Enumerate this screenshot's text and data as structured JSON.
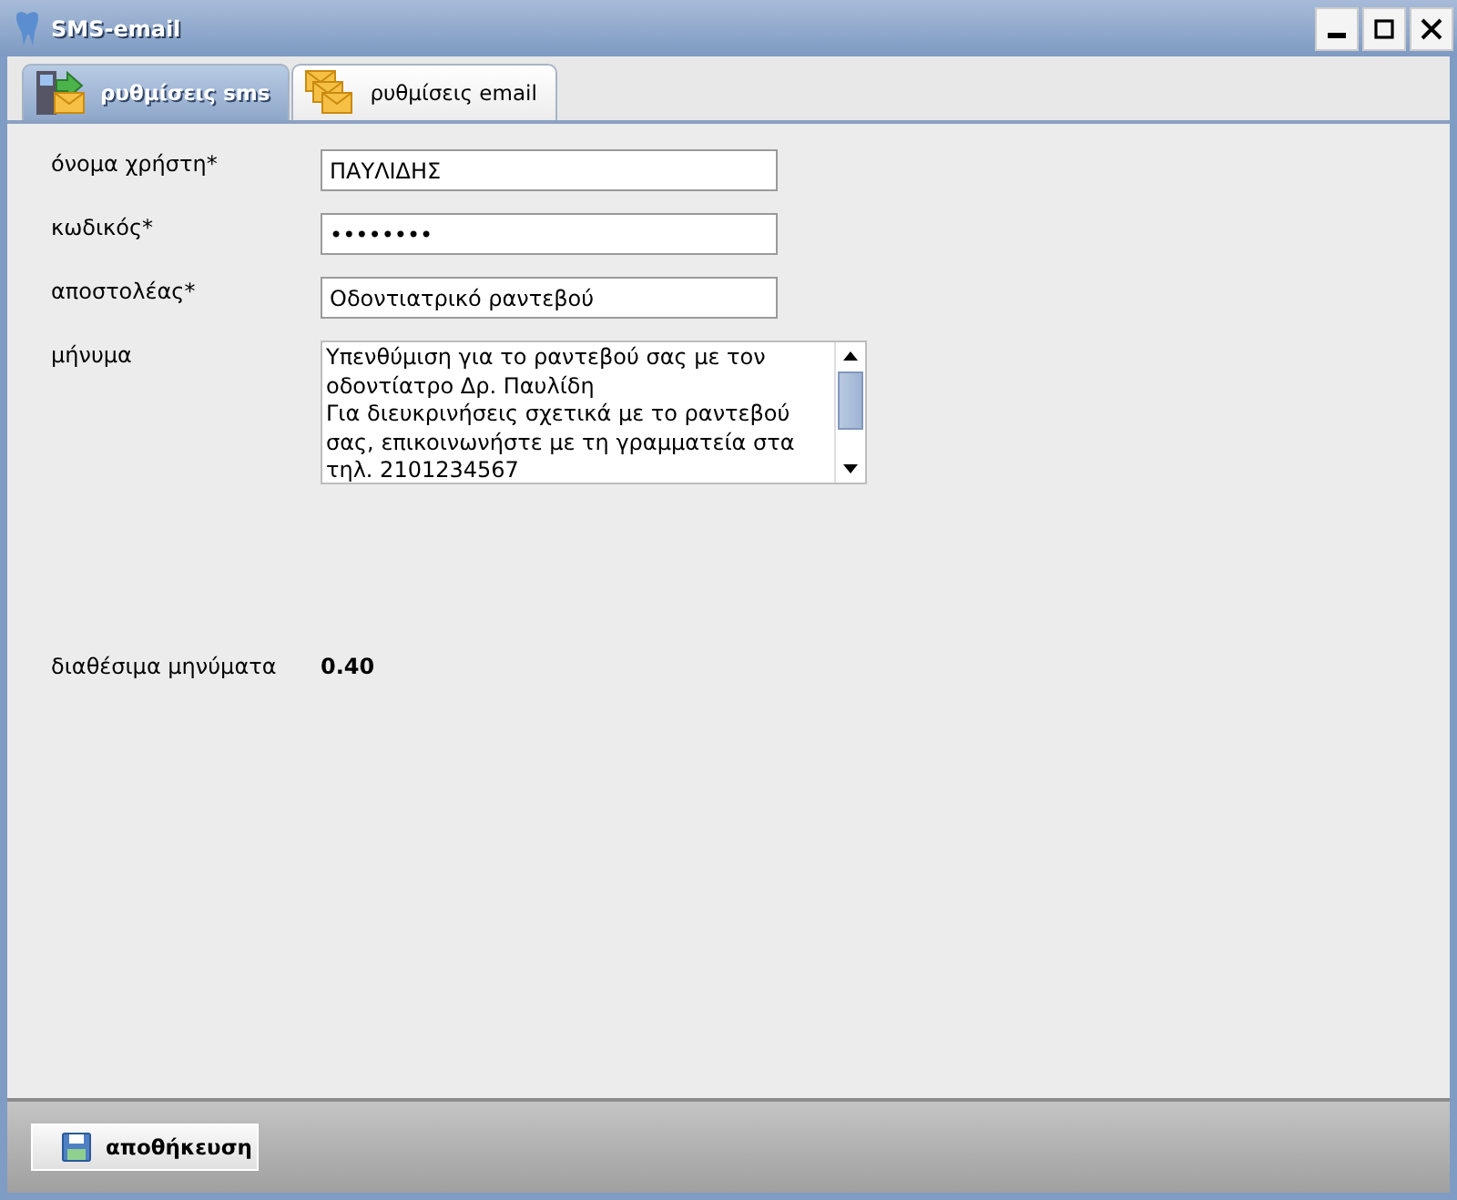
{
  "window": {
    "title": "SMS-email"
  },
  "tabs": [
    {
      "label": "ρυθμίσεις sms",
      "selected": true,
      "kind": "sms"
    },
    {
      "label": "ρυθμίσεις email",
      "selected": false,
      "kind": "email"
    }
  ],
  "fields": [
    {
      "label": "όνομα χρήστη*",
      "value": "ΠΑΥΛΙΔΗΣ"
    },
    {
      "label": "κωδικός*",
      "value": "••••••••"
    },
    {
      "label": "αποστολέας*",
      "value": "Οδοντιατρικό ραντεβού"
    }
  ],
  "message": {
    "label": "μήνυμα",
    "lines": [
      "Υπενθύμιση για το ραντεβού σας με τον",
      "οδοντίατρο Δρ. Παυλίδη",
      "Για διευκρινήσεις σχετικά με το ραντεβού",
      "σας, επικοινωνήστε με τη γραμματεία στα",
      "τηλ. 2101234567"
    ]
  },
  "available": {
    "label": "διαθέσιμα μηνύματα",
    "value": "0.40"
  },
  "save_button": {
    "label": "αποθήκευση"
  }
}
